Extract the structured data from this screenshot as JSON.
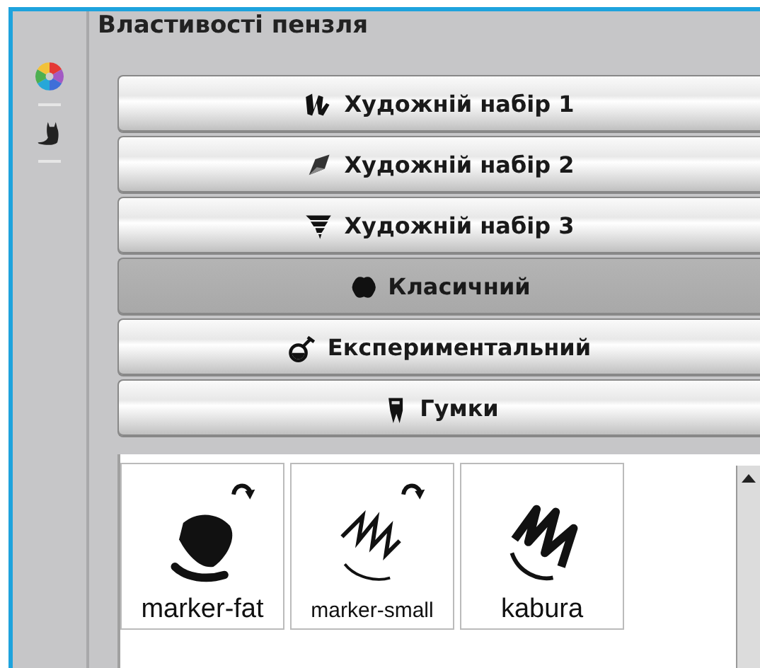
{
  "panel": {
    "title": "Властивості пензля"
  },
  "groups": [
    {
      "label": "Художній набір 1",
      "selected": false
    },
    {
      "label": "Художній набір 2",
      "selected": false
    },
    {
      "label": "Художній набір 3",
      "selected": false
    },
    {
      "label": "Класичний",
      "selected": true
    },
    {
      "label": "Експериментальний",
      "selected": false
    },
    {
      "label": "Гумки",
      "selected": false
    }
  ],
  "brushes": [
    {
      "name": "marker-fat",
      "badge": true
    },
    {
      "name": "marker-small",
      "badge": true
    },
    {
      "name": "kabura",
      "badge": false
    }
  ]
}
